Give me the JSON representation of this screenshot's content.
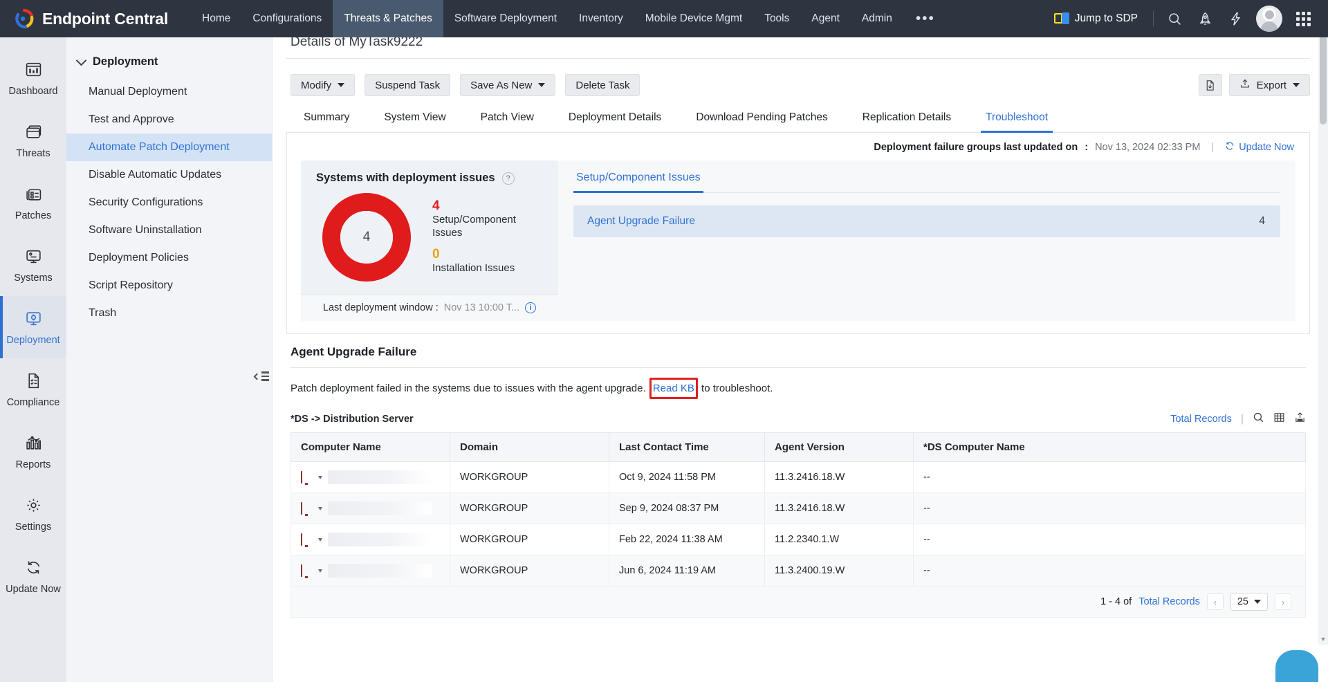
{
  "topbar": {
    "brand": "Endpoint Central",
    "nav": [
      {
        "label": "Home",
        "active": false
      },
      {
        "label": "Configurations",
        "active": false
      },
      {
        "label": "Threats & Patches",
        "active": true
      },
      {
        "label": "Software Deployment",
        "active": false
      },
      {
        "label": "Inventory",
        "active": false
      },
      {
        "label": "Mobile Device Mgmt",
        "active": false
      },
      {
        "label": "Tools",
        "active": false
      },
      {
        "label": "Agent",
        "active": false
      },
      {
        "label": "Admin",
        "active": false
      }
    ],
    "more": "•••",
    "jump_to_sdp": "Jump to SDP",
    "icons": [
      "search-icon",
      "rocket-icon",
      "bolt-icon",
      "avatar",
      "apps-grid-icon"
    ]
  },
  "rail": [
    {
      "label": "Dashboard",
      "icon": "dashboard-icon",
      "active": false
    },
    {
      "label": "Threats",
      "icon": "threats-icon",
      "active": false
    },
    {
      "label": "Patches",
      "icon": "patches-icon",
      "active": false
    },
    {
      "label": "Systems",
      "icon": "systems-icon",
      "active": false
    },
    {
      "label": "Deployment",
      "icon": "deployment-icon",
      "active": true
    },
    {
      "label": "Compliance",
      "icon": "compliance-icon",
      "active": false
    },
    {
      "label": "Reports",
      "icon": "reports-icon",
      "active": false
    },
    {
      "label": "Settings",
      "icon": "settings-gear-icon",
      "active": false
    },
    {
      "label": "Update Now",
      "icon": "refresh-icon",
      "active": false
    }
  ],
  "subnav": {
    "header": "Deployment",
    "items": [
      {
        "label": "Manual Deployment",
        "active": false
      },
      {
        "label": "Test and Approve",
        "active": false
      },
      {
        "label": "Automate Patch Deployment",
        "active": true
      },
      {
        "label": "Disable Automatic Updates",
        "active": false
      },
      {
        "label": "Security Configurations",
        "active": false
      },
      {
        "label": "Software Uninstallation",
        "active": false
      },
      {
        "label": "Deployment Policies",
        "active": false
      },
      {
        "label": "Script Repository",
        "active": false
      },
      {
        "label": "Trash",
        "active": false
      }
    ]
  },
  "page": {
    "title": "Details of MyTask9222",
    "buttons": [
      {
        "label": "Modify",
        "dropdown": true
      },
      {
        "label": "Suspend Task",
        "dropdown": false
      },
      {
        "label": "Save As New",
        "dropdown": true
      },
      {
        "label": "Delete Task",
        "dropdown": false
      }
    ],
    "export_label": "Export",
    "doc_icon": "document-download-icon"
  },
  "tabs": [
    {
      "label": "Summary",
      "active": false
    },
    {
      "label": "System View",
      "active": false
    },
    {
      "label": "Patch View",
      "active": false
    },
    {
      "label": "Deployment Details",
      "active": false
    },
    {
      "label": "Download Pending Patches",
      "active": false
    },
    {
      "label": "Replication Details",
      "active": false
    },
    {
      "label": "Troubleshoot",
      "active": true
    }
  ],
  "panel": {
    "last_updated_label": "Deployment failure groups last updated on",
    "last_updated_value": "Nov 13, 2024 02:33 PM",
    "update_now": "Update Now"
  },
  "chart_data": {
    "type": "pie",
    "title": "Systems with deployment issues",
    "center_value": "4",
    "categories": [
      "Setup/Component Issues",
      "Installation Issues"
    ],
    "values": [
      4,
      0
    ],
    "colors": [
      "#e01b1b",
      "#e8a317"
    ],
    "legend_position": "right",
    "total": 4
  },
  "card": {
    "help_glyph": "?",
    "footer_label": "Last deployment window :",
    "footer_value": "Nov 13 10:00 T...",
    "info_glyph": "i"
  },
  "issues_panel": {
    "tab": "Setup/Component Issues",
    "rows": [
      {
        "name": "Agent Upgrade Failure",
        "count": "4"
      }
    ]
  },
  "section": {
    "title": "Agent Upgrade Failure",
    "desc_before": "Patch deployment failed in the systems due to issues with the agent upgrade.",
    "kb_link": "Read KB",
    "desc_after": "to troubleshoot.",
    "ds_note": "*DS -> Distribution Server",
    "total_records_link": "Total Records",
    "tools": [
      "search-icon",
      "table-columns-icon",
      "export-upload-icon"
    ]
  },
  "table": {
    "columns": [
      "Computer Name",
      "Domain",
      "Last Contact Time",
      "Agent Version",
      "*DS Computer Name"
    ],
    "rows": [
      {
        "computer": "",
        "domain": "WORKGROUP",
        "last_contact": "Oct 9, 2024 11:58 PM",
        "agent_version": "11.3.2416.18.W",
        "ds_computer": "--"
      },
      {
        "computer": "",
        "domain": "WORKGROUP",
        "last_contact": "Sep 9, 2024 08:37 PM",
        "agent_version": "11.3.2416.18.W",
        "ds_computer": "--"
      },
      {
        "computer": "",
        "domain": "WORKGROUP",
        "last_contact": "Feb 22, 2024 11:38 AM",
        "agent_version": "11.2.2340.1.W",
        "ds_computer": "--"
      },
      {
        "computer": "",
        "domain": "WORKGROUP",
        "last_contact": "Jun 6, 2024 11:19 AM",
        "agent_version": "11.3.2400.19.W",
        "ds_computer": "--"
      }
    ]
  },
  "pagination": {
    "range_text": "1 - 4 of",
    "total_link": "Total Records",
    "page_size": "25",
    "prev": "‹",
    "next": "›"
  },
  "colors": {
    "accent": "#2f72d6",
    "danger": "#e01b1b",
    "warning": "#e8a317",
    "topbar": "#2e3440",
    "highlight_box": "#e02020"
  }
}
